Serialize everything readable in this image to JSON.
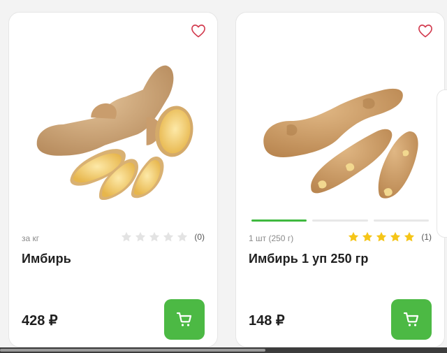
{
  "colors": {
    "accent": "#4cb944",
    "star_filled": "#f5c518",
    "star_empty": "#e3e3e3",
    "carousel_active": "#3fb93f"
  },
  "products": [
    {
      "unit": "за кг",
      "rating_count": "(0)",
      "rating_value": 0,
      "name": "Имбирь",
      "price": "428 ₽",
      "favorite_icon": "heart-outline-icon",
      "cart_icon": "cart-icon"
    },
    {
      "unit": "1 шт (250 г)",
      "rating_count": "(1)",
      "rating_value": 5,
      "name": "Имбирь 1 уп 250 гр",
      "price": "148 ₽",
      "favorite_icon": "heart-outline-icon",
      "cart_icon": "cart-icon",
      "carousel": {
        "total": 3,
        "active": 1
      }
    }
  ]
}
